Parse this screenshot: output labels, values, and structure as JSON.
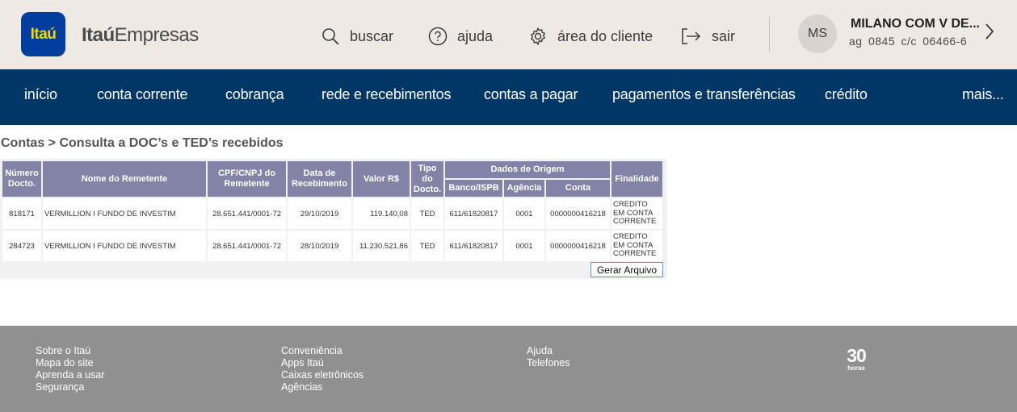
{
  "header": {
    "logo_text": "Itaú",
    "brand_bold": "Itaú",
    "brand_regular": "Empresas",
    "links": [
      {
        "label": "buscar",
        "icon": "search-icon"
      },
      {
        "label": "ajuda",
        "icon": "help-icon"
      },
      {
        "label": "área do cliente",
        "icon": "gear-icon"
      },
      {
        "label": "sair",
        "icon": "logout-icon"
      }
    ],
    "account": {
      "initials": "MS",
      "name": "MILANO COM V DE...",
      "info": "ag 0845  c/c 06466-6"
    }
  },
  "nav": {
    "items": [
      "início",
      "conta corrente",
      "cobrança",
      "rede e recebimentos",
      "contas a pagar",
      "pagamentos e transferências",
      "crédito",
      "mais..."
    ]
  },
  "breadcrumb": "Contas > Consulta a DOC’s e TED’s recebidos",
  "table": {
    "headers": {
      "numero": "Número Docto.",
      "nome": "Nome do Remetente",
      "cpf": "CPF/CNPJ do Remetente",
      "data": "Data de Recebimento",
      "valor": "Valor R$",
      "tipo": "Tipo do Docto.",
      "origem": "Dados de Origem",
      "banco": "Banco/ISPB",
      "agencia": "Agência",
      "conta": "Conta",
      "finalidade": "Finalidade"
    },
    "rows": [
      {
        "numero": "818171",
        "nome": "VERMILLION I FUNDO DE INVESTIM",
        "cpf": "28.651.441/0001-72",
        "data": "29/10/2019",
        "valor": "119.140,08",
        "tipo": "TED",
        "banco": "611/61820817",
        "agencia": "0001",
        "conta": "0000000416218",
        "finalidade": "CREDITO EM CONTA CORRENTE"
      },
      {
        "numero": "284723",
        "nome": "VERMILLION I FUNDO DE INVESTIM",
        "cpf": "28.651.441/0001-72",
        "data": "28/10/2019",
        "valor": "11.230.521,86",
        "tipo": "TED",
        "banco": "611/61820817",
        "agencia": "0001",
        "conta": "0000000416218",
        "finalidade": "CREDITO EM CONTA CORRENTE"
      }
    ],
    "button_label": "Gerar Arquivo"
  },
  "footer": {
    "col1": [
      "Sobre o Itaú",
      "Mapa do site",
      "Aprenda a usar",
      "Segurança"
    ],
    "col2": [
      "Conveniência",
      "Apps Itaú",
      "Caixas eletrônicos",
      "Agências"
    ],
    "col3": [
      "Ajuda",
      "Telefones"
    ],
    "logo_number": "30",
    "logo_word": "horas"
  },
  "colors": {
    "header_bg": "#efe9e5",
    "nav_bg": "#003767",
    "logo_bg": "#003d9e",
    "logo_text": "#f3d600",
    "table_header": "#8283a6",
    "footer_bg": "#909090"
  }
}
